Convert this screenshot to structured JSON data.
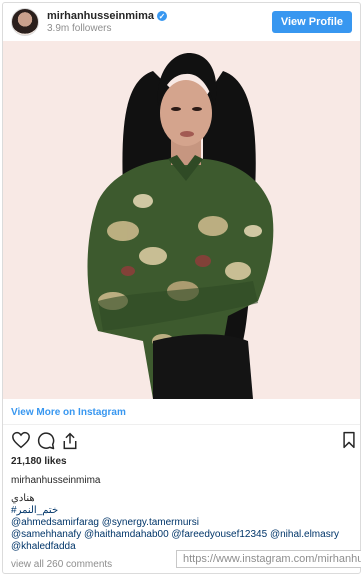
{
  "header": {
    "username": "mirhanhusseinmima",
    "followers": "3.9m followers",
    "view_profile_label": "View Profile",
    "verified_icon": "verified-badge-icon"
  },
  "photo": {
    "subject": "woman in green paisley satin shirt",
    "background_color": "#f7e8e4"
  },
  "links": {
    "view_more": "View More on Instagram"
  },
  "actions": {
    "icons": [
      "heart-icon",
      "comment-icon",
      "share-icon",
      "bookmark-icon"
    ]
  },
  "post": {
    "likes": "21,180 likes",
    "caption_user": "mirhanhusseinmima",
    "caption_lines": [
      "هنادي",
      "#ختم_النمر"
    ],
    "mentions_line1": "@ahmedsamirfarag @synergy.tamermursi",
    "mentions_line2": "@samehhanafy @haithamdahab00 @fareedyousef12345 @nihal.elmasry",
    "mentions_line3": "@khaledfadda",
    "comments_peek": "view all 260 comments"
  },
  "tooltip": {
    "url": "https://www.instagram.com/mirhanhusseinmima"
  },
  "colors": {
    "accent": "#3897f0",
    "mention": "#003569",
    "text": "#262626",
    "muted": "#8e8e8e"
  }
}
